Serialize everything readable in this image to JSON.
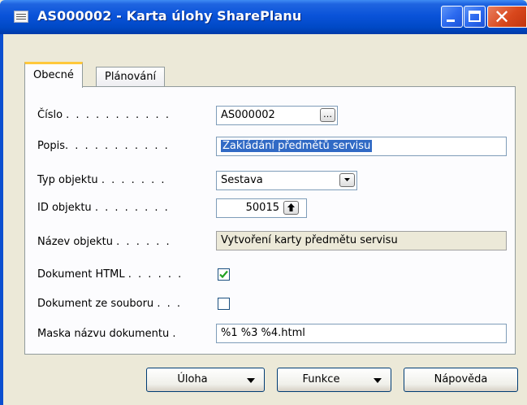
{
  "window": {
    "title": "AS000002 - Karta úlohy SharePlanu",
    "icon": "card-icon"
  },
  "tabs": [
    {
      "label": "Obecné",
      "active": true
    },
    {
      "label": "Plánování",
      "active": false
    }
  ],
  "fields": {
    "cislo": {
      "label": "Číslo",
      "dots": ". . . . . . . . . . .",
      "value": "AS000002"
    },
    "popis": {
      "label": "Popis",
      "dots": ". . . . . . . . . . .",
      "value": "Zakládání předmětů servisu"
    },
    "typ": {
      "label": "Typ objektu",
      "dots": ". . . . . . .",
      "value": "Sestava"
    },
    "id": {
      "label": "ID objektu",
      "dots": ". . . . . . . .",
      "value": "50015"
    },
    "nazev": {
      "label": "Název objektu",
      "dots": ". . . . . .",
      "value": "Vytvoření karty předmětu servisu"
    },
    "html": {
      "label": "Dokument HTML",
      "dots": ". . . . . .",
      "checked": true
    },
    "soubor": {
      "label": "Dokument ze souboru",
      "dots": ". . .",
      "checked": false
    },
    "maska": {
      "label": "Maska názvu dokumentu",
      "dots": ".",
      "value": "%1 %3 %4.html"
    }
  },
  "buttons": {
    "uloha": "Úloha",
    "funkce": "Funkce",
    "napoveda": "Nápověda"
  },
  "colors": {
    "titlebar": "#0a53d9",
    "selection": "#316ac5",
    "tab_highlight": "#ffc83c",
    "checkmark": "#21a121"
  }
}
